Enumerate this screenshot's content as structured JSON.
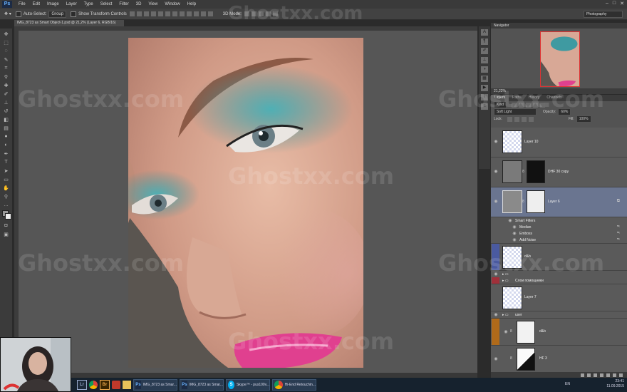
{
  "menu": {
    "app_logo": "Ps",
    "items": [
      "File",
      "Edit",
      "Image",
      "Layer",
      "Type",
      "Select",
      "Filter",
      "3D",
      "View",
      "Window",
      "Help"
    ],
    "window_controls": [
      "–",
      "□",
      "✕"
    ]
  },
  "options_bar": {
    "auto_select_label": "Auto-Select:",
    "auto_select_value": "Group",
    "show_transform_label": "Show Transform Controls",
    "mode_3d_label": "3D Mode:",
    "workspace": "Photography"
  },
  "document": {
    "tab_title": "IMG_8723 as Smart Object-1.psd @ 21,2% (Layer 6, RGB/16)"
  },
  "navigator": {
    "title": "Navigator",
    "zoom": "21,22%"
  },
  "layers_panel": {
    "tabs": [
      "Layers",
      "Paths",
      "History",
      "Channels"
    ],
    "filter_label": "Kind",
    "blend_mode": "Soft Light",
    "opacity_label": "Opacity:",
    "opacity_value": "60%",
    "lock_label": "Lock:",
    "fill_label": "Fill:",
    "fill_value": "100%",
    "layers": [
      {
        "name": "Layer 10"
      },
      {
        "name": "DHF 30 copy"
      },
      {
        "name": "Layer 6"
      },
      {
        "name": "Smart Filters"
      },
      {
        "name": "Median"
      },
      {
        "name": "Emboss"
      },
      {
        "name": "Add Noise"
      },
      {
        "name": "d&b"
      },
      {
        "name": "Слои помощники"
      },
      {
        "name": "Layer 7"
      },
      {
        "name": "user"
      },
      {
        "name": "d&b"
      },
      {
        "name": "HF 3"
      }
    ]
  },
  "taskbar": {
    "apps": [
      "Lr",
      "Br"
    ],
    "windows": [
      "IMG_8723 as Smar...",
      "IMG_8723 as Smar...",
      "Skype™ - pus100v...",
      "Hi-End Retouchin..."
    ],
    "lang": "EN",
    "time": "23:41",
    "date": "11.09.2015"
  },
  "watermark": "Ghostxx.com",
  "colors": {
    "accent": "#6ab4ff",
    "selected_layer": "#6a7590",
    "lips": "#e0408f",
    "eyeshadow": "#3a9aa2"
  }
}
